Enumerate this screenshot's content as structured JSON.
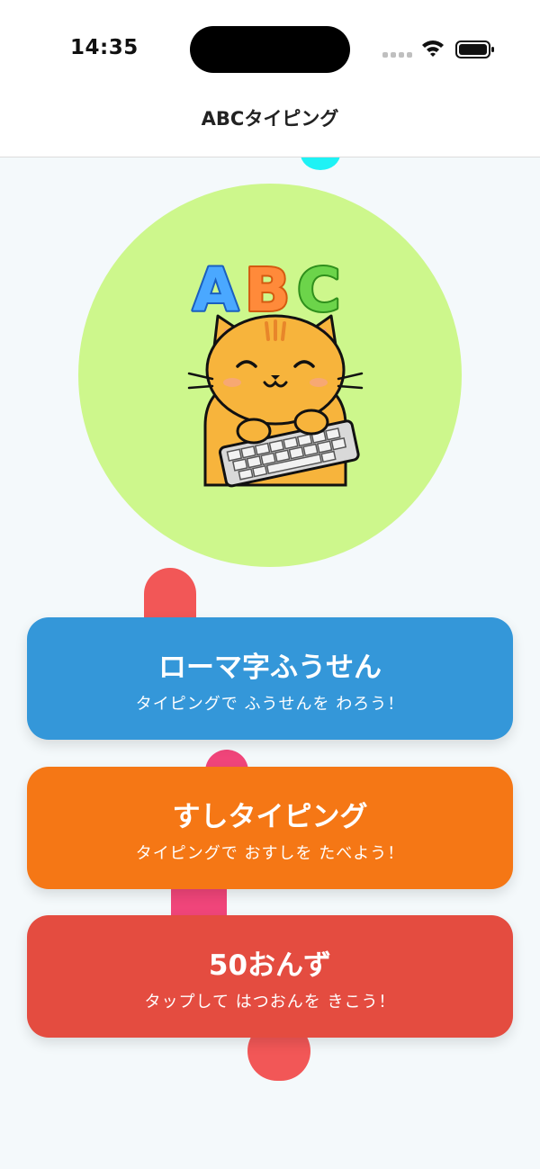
{
  "status_bar": {
    "time": "14:35"
  },
  "nav": {
    "title": "ABCタイピング"
  },
  "hero": {
    "logo_text": "ABC",
    "circle_color": "#cdf78c"
  },
  "colors": {
    "blue": "#3497d9",
    "orange": "#f57715",
    "red": "#e44c40",
    "background": "#f4f9fb"
  },
  "menu": [
    {
      "title": "ローマ字ふうせん",
      "subtitle": "タイピングで ふうせんを わろう！"
    },
    {
      "title": "すしタイピング",
      "subtitle": "タイピングで おすしを たべよう！"
    },
    {
      "title": "50おんず",
      "subtitle": "タップして はつおんを きこう！"
    }
  ]
}
